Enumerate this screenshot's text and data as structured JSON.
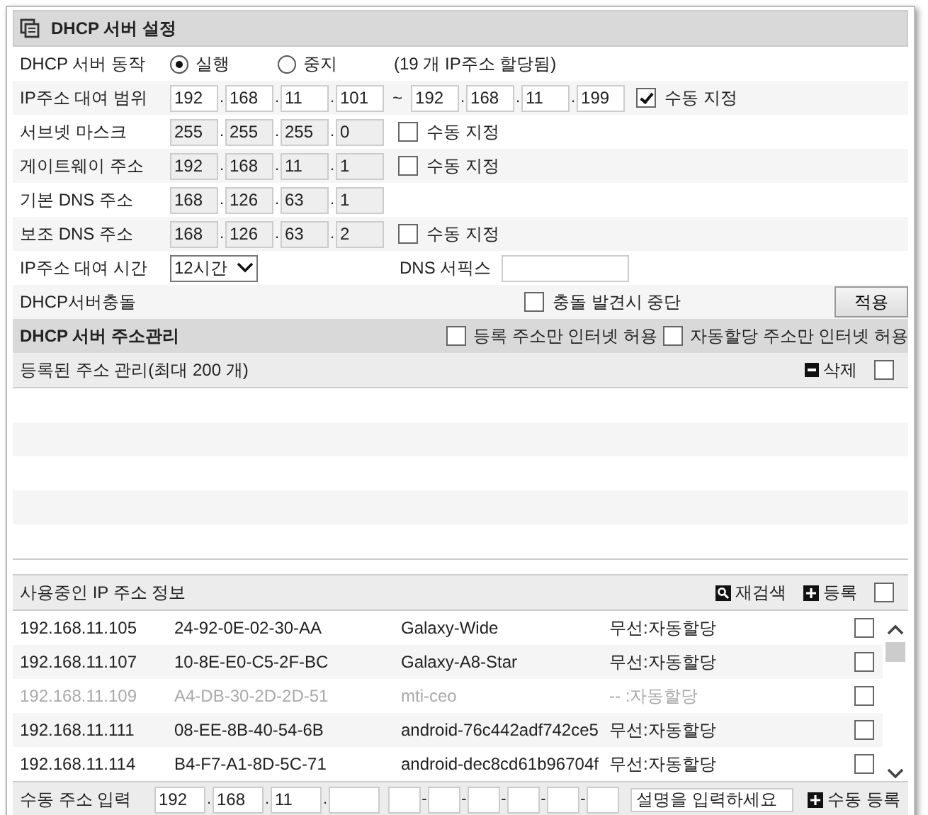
{
  "title": "DHCP 서버 설정",
  "ip_separator": ".",
  "mac_separator": "-",
  "server_action": {
    "label": "DHCP 서버 동작",
    "options": [
      {
        "label": "실행",
        "selected": true
      },
      {
        "label": "중지",
        "selected": false
      }
    ],
    "note": "(19 개 IP주소 할당됨)"
  },
  "lease_range": {
    "label": "IP주소 대여 범위",
    "start": [
      "192",
      "168",
      "11",
      "101"
    ],
    "separator": "~",
    "end": [
      "192",
      "168",
      "11",
      "199"
    ],
    "manual": {
      "label": "수동 지정",
      "checked": true
    }
  },
  "address_rows": [
    {
      "label": "서브넷 마스크",
      "octets": [
        "255",
        "255",
        "255",
        "0"
      ],
      "disabled": true,
      "manual": {
        "label": "수동 지정",
        "checked": false
      }
    },
    {
      "label": "게이트웨이 주소",
      "octets": [
        "192",
        "168",
        "11",
        "1"
      ],
      "disabled": true,
      "manual": {
        "label": "수동 지정",
        "checked": false
      }
    },
    {
      "label": "기본 DNS 주소",
      "octets": [
        "168",
        "126",
        "63",
        "1"
      ],
      "disabled": true
    },
    {
      "label": "보조 DNS 주소",
      "octets": [
        "168",
        "126",
        "63",
        "2"
      ],
      "disabled": true,
      "manual": {
        "label": "수동 지정",
        "checked": false
      }
    }
  ],
  "lease_time": {
    "label": "IP주소 대여 시간",
    "value": "12시간",
    "dns_suffix_label": "DNS 서픽스"
  },
  "conflict": {
    "label": "DHCP서버충돌",
    "option": {
      "label": "충돌 발견시 중단",
      "checked": false
    },
    "apply_button": "적용"
  },
  "address_management": {
    "title": "DHCP 서버 주소관리",
    "options": [
      {
        "label": "등록 주소만 인터넷 허용",
        "checked": false
      },
      {
        "label": "자동할당 주소만 인터넷 허용",
        "checked": false
      }
    ]
  },
  "registered": {
    "title": "등록된 주소 관리(최대 200 개)",
    "delete_label": "삭제",
    "checked": false
  },
  "in_use": {
    "title": "사용중인 IP 주소 정보",
    "rescan_label": "재검색",
    "register_label": "등록",
    "checked": false,
    "rows": [
      {
        "ip": "192.168.11.105",
        "mac": "24-92-0E-02-30-AA",
        "name": "Galaxy-Wide",
        "type": "무선:자동할당",
        "disabled": false,
        "checked": false
      },
      {
        "ip": "192.168.11.107",
        "mac": "10-8E-E0-C5-2F-BC",
        "name": "Galaxy-A8-Star",
        "type": "무선:자동할당",
        "disabled": false,
        "checked": false
      },
      {
        "ip": "192.168.11.109",
        "mac": "A4-DB-30-2D-2D-51",
        "name": "mti-ceo",
        "type": "-- :자동할당",
        "disabled": true,
        "checked": false
      },
      {
        "ip": "192.168.11.111",
        "mac": "08-EE-8B-40-54-6B",
        "name": "android-76c442adf742ce5",
        "type": "무선:자동할당",
        "disabled": false,
        "checked": false
      },
      {
        "ip": "192.168.11.114",
        "mac": "B4-F7-A1-8D-5C-71",
        "name": "android-dec8cd61b96704f",
        "type": "무선:자동할당",
        "disabled": false,
        "checked": false
      }
    ]
  },
  "manual_entry": {
    "label": "수동 주소 입력",
    "octets": [
      {
        "kind": "text",
        "value": "192"
      },
      {
        "kind": "text",
        "value": "168"
      },
      {
        "kind": "text",
        "value": "11"
      },
      {
        "kind": "blank"
      }
    ],
    "mac_fields": [
      {
        "kind": "blank"
      },
      {
        "kind": "blank"
      },
      {
        "kind": "blank"
      },
      {
        "kind": "blank"
      },
      {
        "kind": "blank"
      },
      {
        "kind": "blank"
      }
    ],
    "description_placeholder": "설명을 입력하세요",
    "button": "수동 등록"
  }
}
